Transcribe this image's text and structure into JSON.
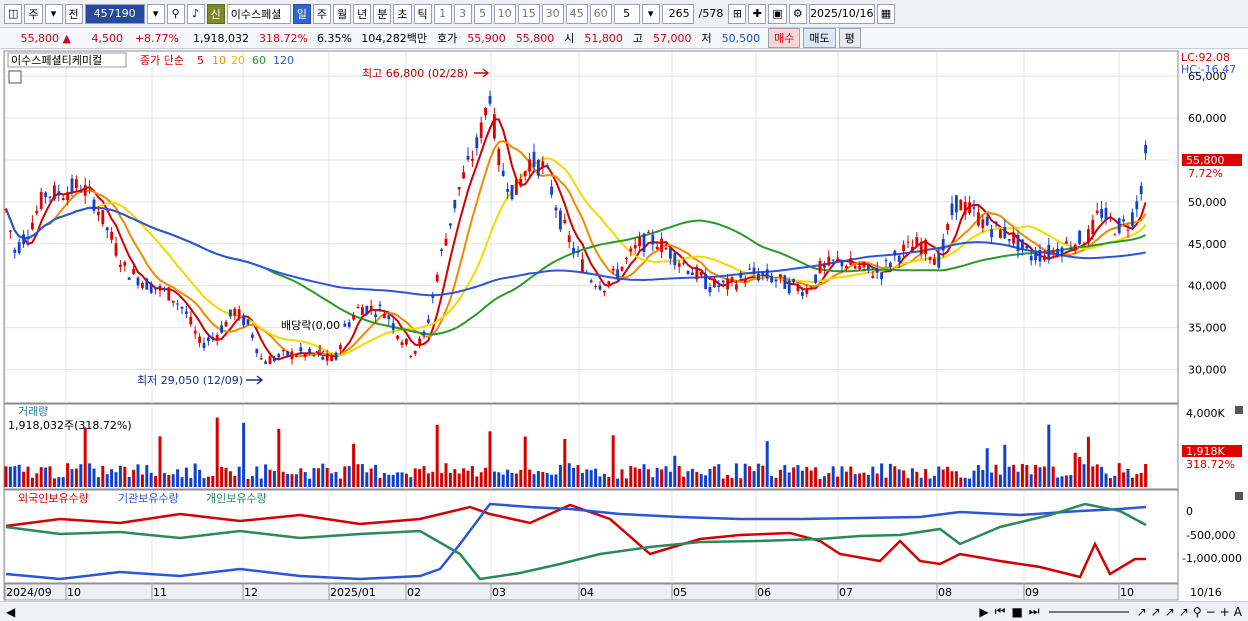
{
  "toolbar": {
    "market": "주",
    "prev": "전",
    "code": "457190",
    "badge": "신",
    "name": "이수스페셜",
    "periods": [
      "일",
      "주",
      "월",
      "년",
      "분",
      "초",
      "틱"
    ],
    "active_period": "일",
    "nums": [
      "1",
      "3",
      "5",
      "10",
      "15",
      "30",
      "45",
      "60"
    ],
    "interval": "5",
    "count": "265",
    "total": "/578",
    "date": "2025/10/16"
  },
  "quote": {
    "price": "55,800",
    "up_sign": "▲",
    "change": "4,500",
    "rate": "+8.77%",
    "volume": "1,918,032",
    "vol_rate": "318.72%",
    "turnover": "6.35%",
    "amount": "104,282백만",
    "ask_label": "호가",
    "ask1": "55,900",
    "ask2": "55,800",
    "open_label": "시",
    "open": "51,800",
    "high_label": "고",
    "high": "57,000",
    "low_label": "저",
    "low": "50,500",
    "buy": "매수",
    "sell": "매도",
    "eval": "평"
  },
  "legend": {
    "name": "이수스페셜티케미컬",
    "prefix": "종가 단순",
    "ma": [
      {
        "label": "5",
        "color": "#d40000"
      },
      {
        "label": "10",
        "color": "#f08a00"
      },
      {
        "label": "20",
        "color": "#f5d800"
      },
      {
        "label": "60",
        "color": "#2a9a2a"
      },
      {
        "label": "120",
        "color": "#2b56d8"
      }
    ]
  },
  "annotations": {
    "high": "최고 66,800 (02/28)",
    "low": "최저 29,050 (12/09)",
    "dividend": "배당락(0,00"
  },
  "price_axis": {
    "top_lc": "LC:92.08",
    "top_hc": "HC:-16.47",
    "ticks": [
      "65,000",
      "60,000",
      "55,000",
      "50,000",
      "45,000",
      "40,000",
      "35,000",
      "30,000"
    ],
    "current": "55,800",
    "current_pct": "7.72%"
  },
  "volume_panel": {
    "title": "거래량",
    "value": "1,918,032주(318.72%)",
    "axis_top": "4,000K",
    "current": "1,918K",
    "current_pct": "318.72%"
  },
  "holdings_panel": {
    "legend": [
      "외국인보유수량",
      "기관보유수량",
      "개인보유수량"
    ],
    "colors": [
      "#d40000",
      "#2b56d8",
      "#2a8a5a"
    ],
    "ticks": [
      "0",
      "-500,000",
      "-1,000,000"
    ]
  },
  "x_axis": {
    "labels": [
      "2024/09",
      "10",
      "11",
      "12",
      "2025/01",
      "02",
      "03",
      "04",
      "05",
      "06",
      "07",
      "08",
      "09",
      "10"
    ],
    "end": "10/16"
  },
  "chart_data": {
    "type": "candlestick",
    "title": "이수스페셜티케미컬",
    "price_ylim": [
      26000,
      68000
    ],
    "x_range": [
      "2024/09",
      "10/16"
    ],
    "key_points": {
      "high": 66800,
      "high_date": "02/28",
      "low": 29050,
      "low_date": "12/09",
      "last": 55800
    }
  }
}
